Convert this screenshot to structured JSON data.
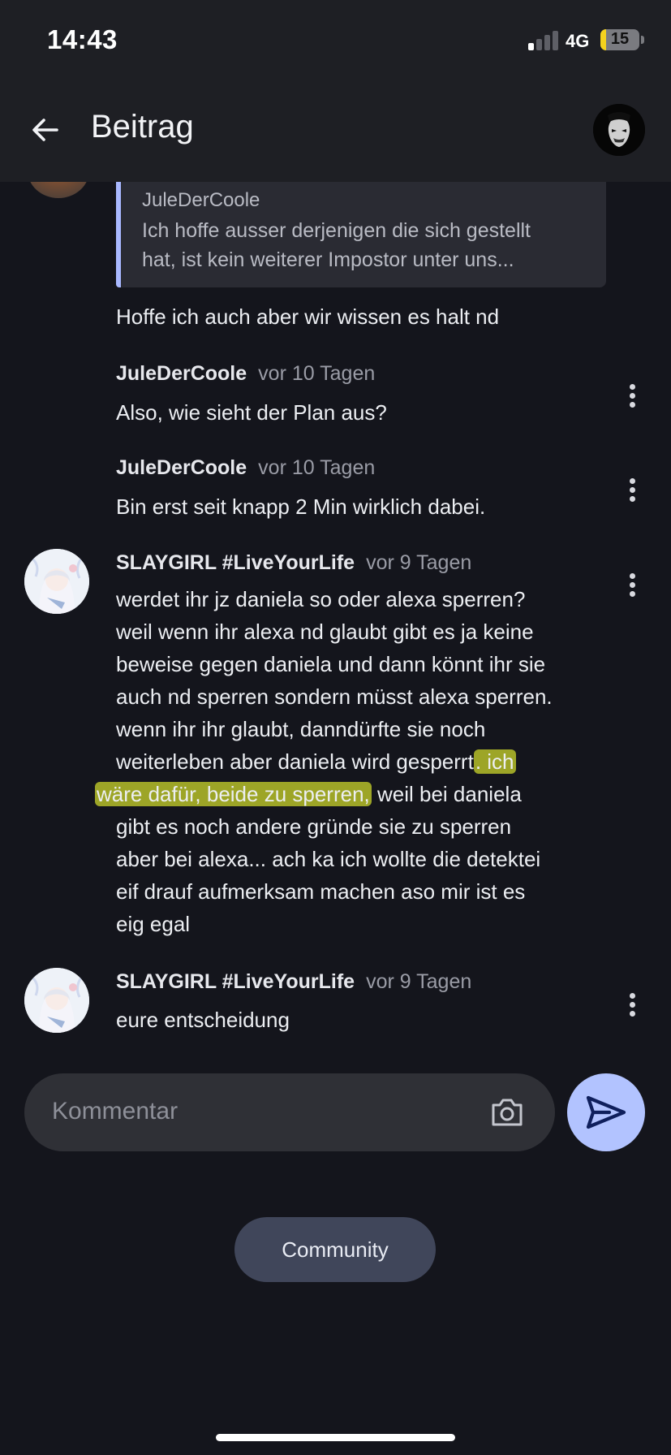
{
  "status_bar": {
    "time": "14:43",
    "network": "4G",
    "battery": "15",
    "battery_level": 0.15
  },
  "header": {
    "title": "Beitrag",
    "back_icon": "arrow-left-icon",
    "profile_icon": "mask-avatar"
  },
  "quote": {
    "author": "JuleDerCoole",
    "lines": [
      "Ich hoffe ausser derjenigen die sich gestellt",
      "hat, ist kein weiterer Impostor unter uns..."
    ]
  },
  "reply_text": "Hoffe ich auch aber wir wissen es halt nd",
  "comments": [
    {
      "author": "JuleDerCoole",
      "time": "vor 10 Tagen",
      "text": "Also, wie sieht der Plan aus?"
    },
    {
      "author": "JuleDerCoole",
      "time": "vor 10 Tagen",
      "text": "Bin erst seit knapp 2 Min wirklich dabei."
    },
    {
      "author": "SLAYGIRL #LiveYourLife",
      "time": "vor 9 Tagen",
      "lines": [
        "werdet ihr jz daniela so oder alexa sperren?",
        "weil wenn ihr alexa nd glaubt gibt es ja keine",
        "beweise gegen daniela und dann könnt ihr sie",
        "auch nd sperren sondern müsst alexa sperren.",
        "wenn ihr ihr glaubt, danndürfte sie noch",
        "weiterleben aber daniela wird gesperrt",
        "wäre dafür, beide zu sperren,",
        "gibt es noch andere gründe sie zu sperren",
        "aber bei alexa... ach ka ich wollte die detektei",
        "eif drauf aufmerksam machen aso mir ist es",
        "eig egal"
      ],
      "highlight_a": ". ich",
      "line7_rest": " weil bei daniela"
    },
    {
      "author": "SLAYGIRL #LiveYourLife",
      "time": "vor 9 Tagen",
      "text": "eure entscheidung"
    }
  ],
  "comment_input": {
    "placeholder": "Kommentar",
    "camera_icon": "camera-icon",
    "send_icon": "send-icon"
  },
  "community_button": "Community",
  "colors": {
    "accent": "#b2c3ff",
    "highlight": "#c4ce2a",
    "background": "#14151c"
  }
}
